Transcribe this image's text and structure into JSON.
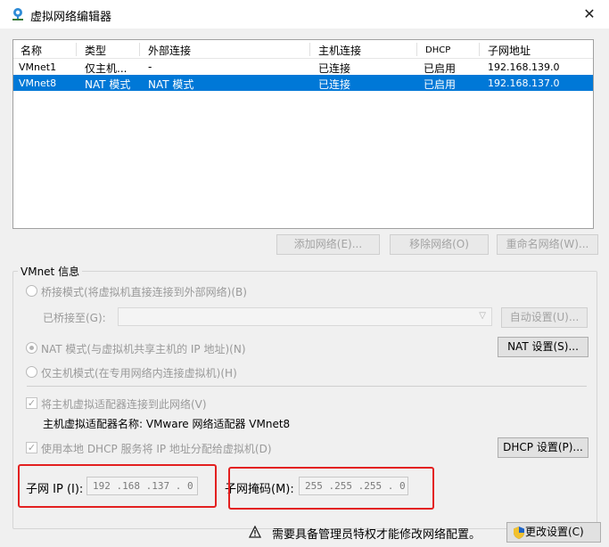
{
  "window": {
    "title": "虚拟网络编辑器",
    "close_glyph": "✕"
  },
  "table": {
    "columns": [
      "名称",
      "类型",
      "外部连接",
      "主机连接",
      "DHCP",
      "子网地址"
    ],
    "rows": [
      [
        "VMnet1",
        "仅主机...",
        "-",
        "已连接",
        "已启用",
        "192.168.139.0"
      ],
      [
        "VMnet8",
        "NAT 模式",
        "NAT 模式",
        "已连接",
        "已启用",
        "192.168.137.0"
      ]
    ],
    "selected_row": 1
  },
  "buttons": {
    "add_network": "添加网络(E)...",
    "remove_network": "移除网络(O)",
    "rename_network": "重命名网络(W)...",
    "auto_settings": "自动设置(U)...",
    "nat_settings": "NAT 设置(S)...",
    "dhcp_settings": "DHCP 设置(P)...",
    "change_settings": "更改设置(C)"
  },
  "vmnet_info": {
    "group_label": "VMnet 信息",
    "bridge_mode": "桥接模式(将虚拟机直接连接到外部网络)(B)",
    "bridged_to_label": "已桥接至(G):",
    "nat_mode": "NAT 模式(与虚拟机共享主机的 IP 地址)(N)",
    "host_only_mode": "仅主机模式(在专用网络内连接虚拟机)(H)",
    "connect_host_adapter": "将主机虚拟适配器连接到此网络(V)",
    "host_adapter_name": "主机虚拟适配器名称: VMware 网络适配器 VMnet8",
    "use_local_dhcp": "使用本地 DHCP 服务将 IP 地址分配给虚拟机(D)",
    "selected_mode": "nat",
    "connect_host_adapter_checked": true,
    "use_local_dhcp_checked": true
  },
  "subnet": {
    "ip_label": "子网 IP (I):",
    "ip_value": "192 .168 .137 . 0",
    "mask_label": "子网掩码(M):",
    "mask_value": "255 .255 .255 . 0"
  },
  "footer": {
    "warning": "需要具备管理员特权才能修改网络配置。"
  },
  "colors": {
    "selection": "#0078d7",
    "highlight_box": "#e32020",
    "shield_blue": "#1e63c6",
    "shield_yellow": "#f2c12e"
  }
}
